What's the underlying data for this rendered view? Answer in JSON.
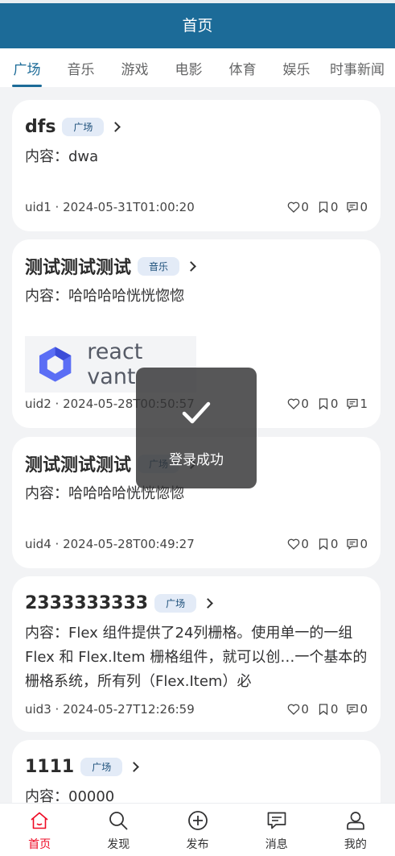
{
  "header": {
    "title": "首页"
  },
  "tabs": [
    {
      "label": "广场",
      "active": true
    },
    {
      "label": "音乐"
    },
    {
      "label": "游戏"
    },
    {
      "label": "电影"
    },
    {
      "label": "体育"
    },
    {
      "label": "娱乐"
    },
    {
      "label": "时事新闻"
    }
  ],
  "posts": [
    {
      "title": "dfs",
      "tag": "广场",
      "content": "内容：dwa",
      "author": "uid1",
      "time": "2024-05-31T01:00:20",
      "likes": "0",
      "favorites": "0",
      "comments": "0"
    },
    {
      "title": "测试测试测试",
      "tag": "音乐",
      "content": "内容：哈哈哈哈恍恍惚惚",
      "image_text": "react vant",
      "author": "uid2",
      "time": "2024-05-28T00:50:57",
      "likes": "0",
      "favorites": "0",
      "comments": "1"
    },
    {
      "title": "测试测试测试",
      "tag": "广场",
      "content": "内容：哈哈哈哈恍恍惚惚",
      "author": "uid4",
      "time": "2024-05-28T00:49:27",
      "likes": "0",
      "favorites": "0",
      "comments": "0"
    },
    {
      "title": "2333333333",
      "tag": "广场",
      "content": "内容：Flex 组件提供了24列栅格。使用单一的一组 Flex 和 Flex.Item 栅格组件，就可以创…一个基本的栅格系统，所有列（Flex.Item）必",
      "author": "uid3",
      "time": "2024-05-27T12:26:59",
      "likes": "0",
      "favorites": "0",
      "comments": "0"
    },
    {
      "title": "1111",
      "tag": "广场",
      "content": "内容：00000"
    }
  ],
  "toast": {
    "text": "登录成功"
  },
  "nav": [
    {
      "label": "首页",
      "icon": "home-icon",
      "active": true
    },
    {
      "label": "发现",
      "icon": "search-icon"
    },
    {
      "label": "发布",
      "icon": "add-circle-icon"
    },
    {
      "label": "消息",
      "icon": "message-icon"
    },
    {
      "label": "我的",
      "icon": "user-icon"
    }
  ],
  "colors": {
    "primary": "#1c6b98",
    "nav_active": "#ee0a24",
    "tag_bg": "#e3ebf7"
  }
}
